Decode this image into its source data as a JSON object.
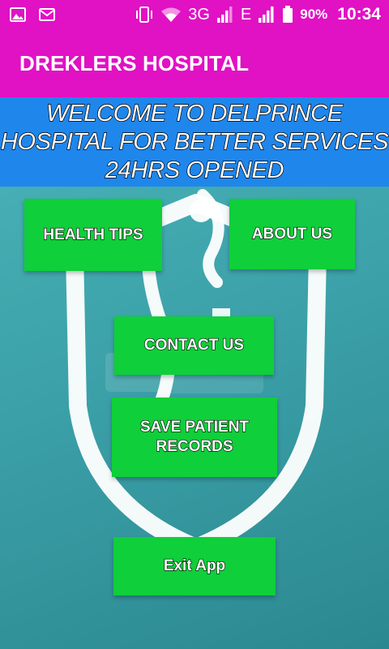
{
  "status_bar": {
    "signal_3g": "3G",
    "signal_e": "E",
    "battery_percent": "90%",
    "time": "10:34",
    "icons": [
      "gallery-icon",
      "mail-icon",
      "vibrate-icon",
      "wifi-icon",
      "signal-icon",
      "battery-icon"
    ]
  },
  "app_bar": {
    "title": "DREKLERS HOSPITAL",
    "color": "#e111c4"
  },
  "welcome": {
    "text": "WELCOME TO DELPRINCE\nHOSPITAL FOR BETTER SERVICES\n24HRS OPENED",
    "color": "#1f86ec"
  },
  "buttons": {
    "health_tips": "HEALTH TIPS",
    "about_us": "ABOUT US",
    "contact_us": "CONTACT US",
    "save_patient_records": "SAVE PATIENT RECORDS",
    "exit_app": "Exit App",
    "color": "#0fcf3a"
  },
  "background": {
    "color": "#2f8f97",
    "icon": "shield-stethoscope-icon"
  }
}
